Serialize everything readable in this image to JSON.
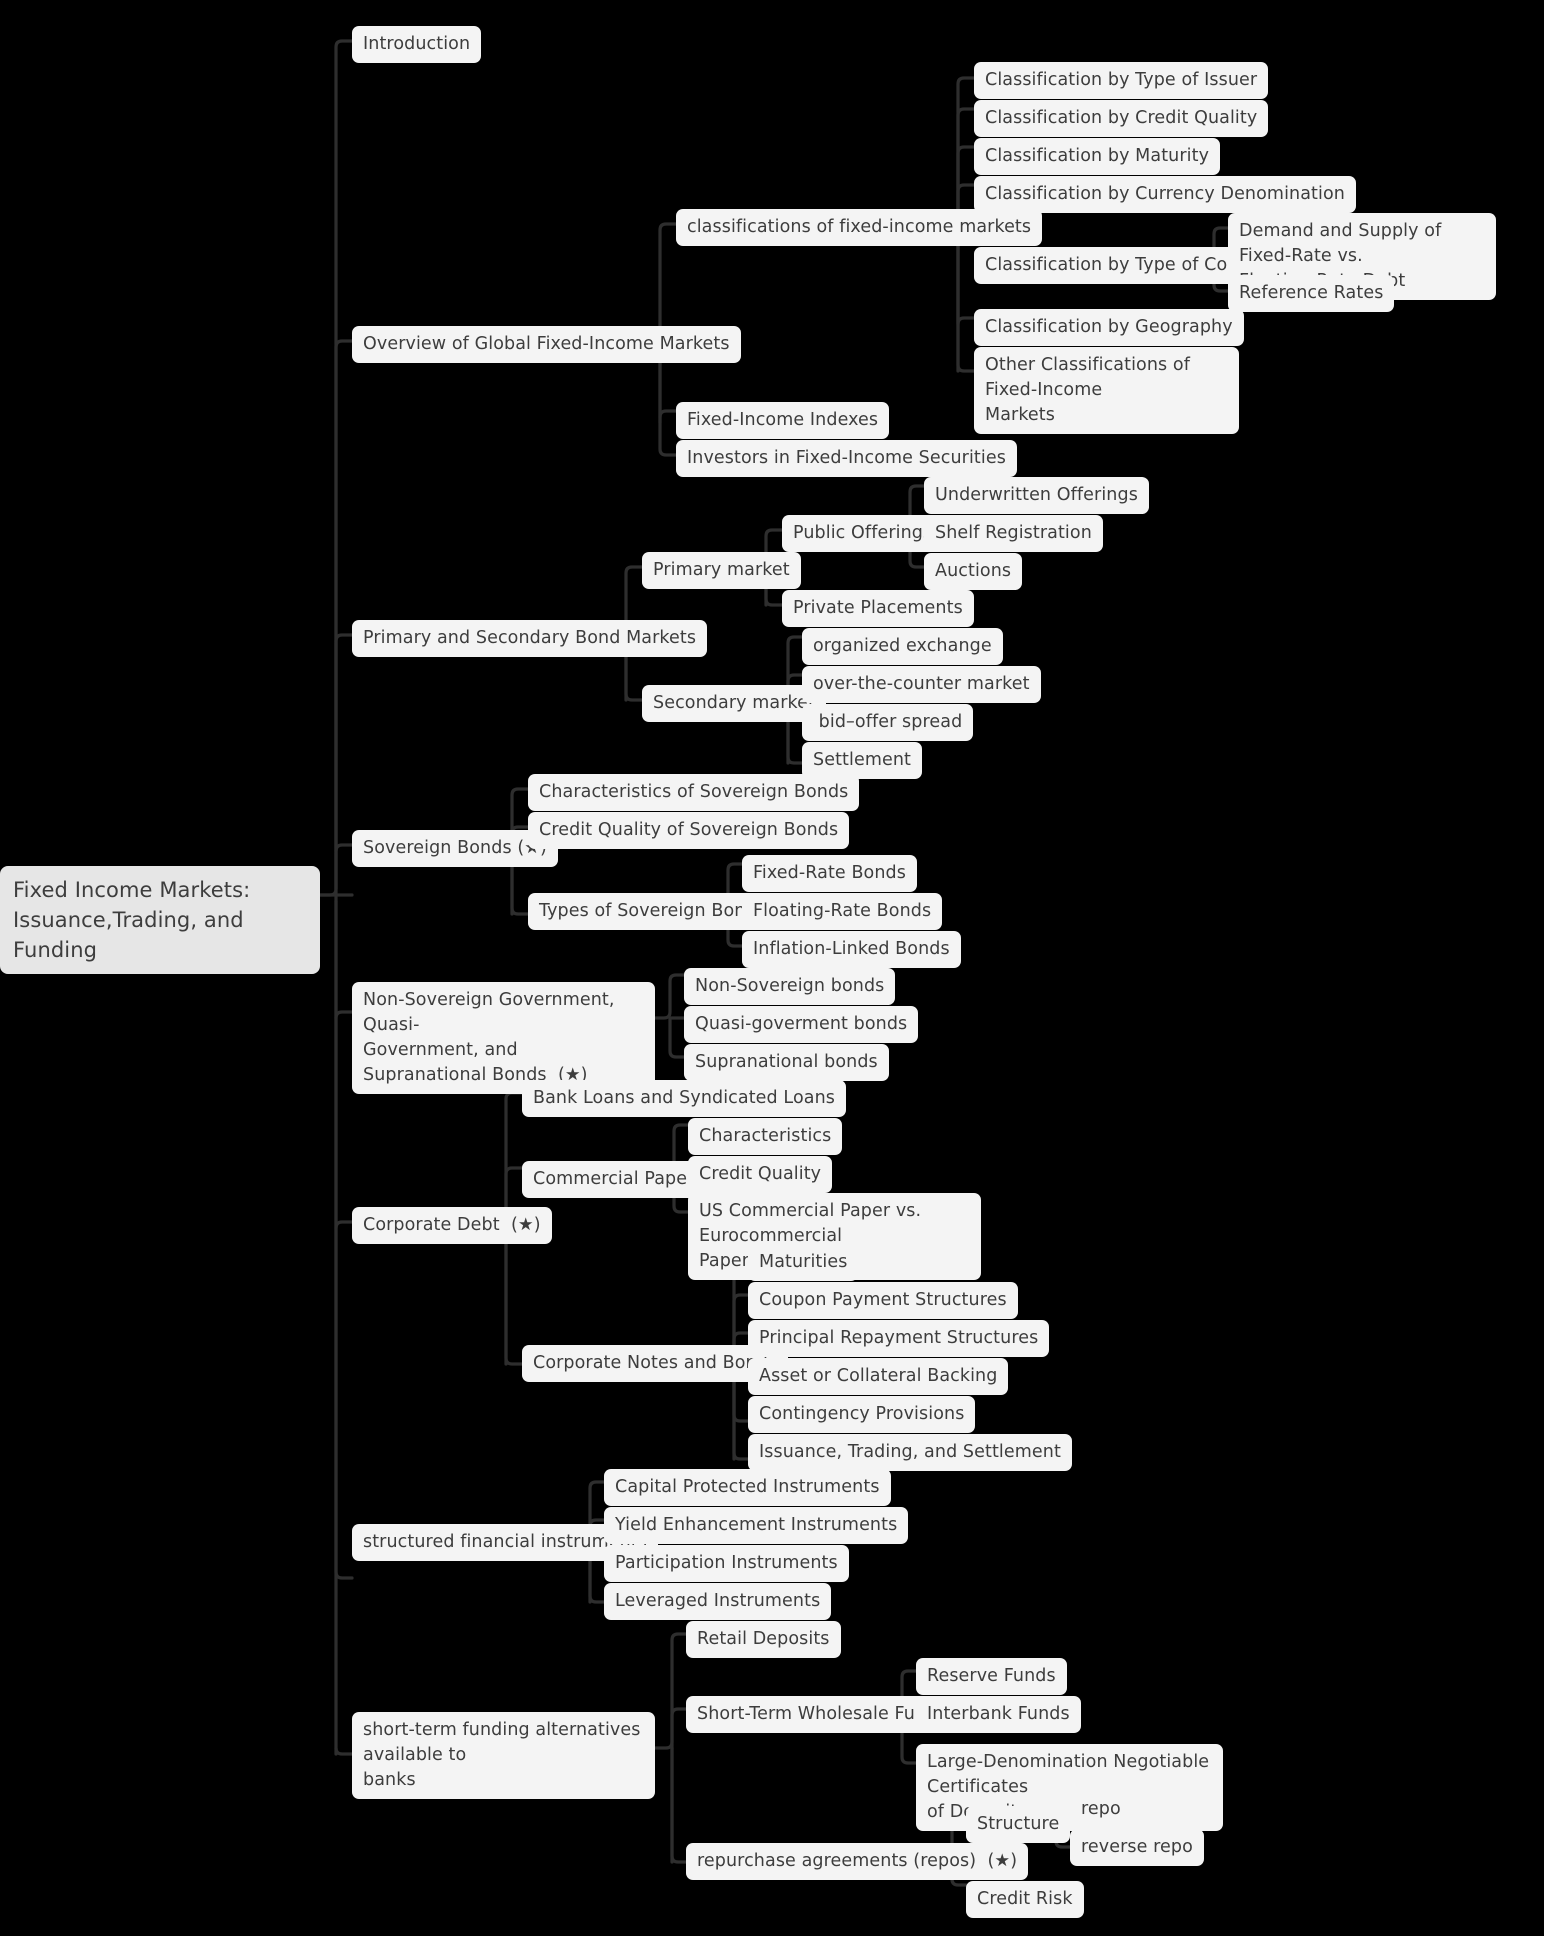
{
  "title": "Fixed Income Markets: Issuance,Trading, and Funding",
  "colors": {
    "background": "#000000",
    "node_fill": "#f4f4f4",
    "root_fill": "#e6e6e6",
    "text": "#3d3d3d",
    "link": "#2e2e2e"
  },
  "nodes": {
    "root": "Fixed Income Markets:\nIssuance,Trading, and Funding",
    "n1": "Introduction",
    "n2": "Overview of Global Fixed-Income Markets",
    "n2_1": "classifications of fixed-income markets",
    "n2_1_1": "Classification by Type of Issuer",
    "n2_1_2": "Classification by Credit Quality",
    "n2_1_3": "Classification by Maturity",
    "n2_1_4": "Classification by Currency Denomination",
    "n2_1_5": "Classification by Type of Coupon",
    "n2_1_5_1": "Demand and Supply of Fixed-Rate vs.\nFloating-Rate Debt",
    "n2_1_5_2": "Reference Rates",
    "n2_1_6": "Classification by Geography",
    "n2_1_7": "Other Classifications of Fixed-Income\nMarkets",
    "n2_2": "Fixed-Income Indexes",
    "n2_3": "Investors in Fixed-Income Securities",
    "n3": "Primary and Secondary Bond Markets",
    "n3_1": "Primary market",
    "n3_1_1": "Public Offerings",
    "n3_1_1_1": "Underwritten Offerings",
    "n3_1_1_2": "Shelf Registration",
    "n3_1_1_3": "Auctions",
    "n3_1_2": "Private Placements",
    "n3_2": "Secondary market",
    "n3_2_1": "organized exchange",
    "n3_2_2": "over-the-counter market",
    "n3_2_3": " bid–offer spread",
    "n3_2_4": "Settlement",
    "n4": "Sovereign Bonds (★)",
    "n4_1": "Characteristics of Sovereign Bonds",
    "n4_2": "Credit Quality of Sovereign Bonds",
    "n4_3": "Types of Sovereign Bonds",
    "n4_3_1": "Fixed-Rate Bonds",
    "n4_3_2": "Floating-Rate Bonds",
    "n4_3_3": "Inflation-Linked Bonds",
    "n5": "Non-Sovereign Government, Quasi-\nGovernment, and Supranational Bonds  (★)",
    "n5_1": "Non-Sovereign bonds",
    "n5_2": "Quasi-goverment bonds",
    "n5_3": "Supranational bonds",
    "n6": "Corporate Debt  (★)",
    "n6_1": "Bank Loans and Syndicated Loans",
    "n6_2": "Commercial Paper",
    "n6_2_1": "Characteristics",
    "n6_2_2": "Credit Quality",
    "n6_2_3": "US Commercial Paper vs. Eurocommercial\nPaper",
    "n6_3": "Corporate Notes and Bonds",
    "n6_3_1": "Maturities",
    "n6_3_2": "Coupon Payment Structures",
    "n6_3_3": "Principal Repayment Structures",
    "n6_3_4": "Asset or Collateral Backing",
    "n6_3_5": "Contingency Provisions",
    "n6_3_6": "Issuance, Trading, and Settlement",
    "n7": "structured financial instruments",
    "n7_1": "Capital Protected Instruments",
    "n7_2": "Yield Enhancement Instruments",
    "n7_3": "Participation Instruments",
    "n7_4": "Leveraged Instruments",
    "n8": "short-term funding alternatives available to\nbanks",
    "n8_1": "Retail Deposits",
    "n8_2": "Short-Term Wholesale Funds",
    "n8_2_1": "Reserve Funds",
    "n8_2_2": "Interbank Funds",
    "n8_2_3": "Large-Denomination Negotiable Certificates\nof Deposit",
    "n8_3": "repurchase agreements (repos)  (★)",
    "n8_3_1": "Structure",
    "n8_3_1_1": "repo",
    "n8_3_1_2": "reverse repo",
    "n8_3_2": "Credit Risk"
  }
}
